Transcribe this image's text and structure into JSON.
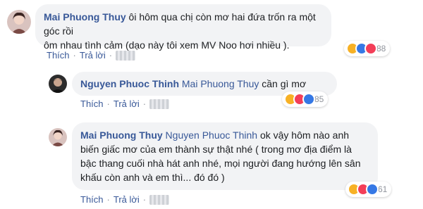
{
  "colors": {
    "author": "#385898",
    "bubble": "#f2f3f5",
    "haha": "#f7b125",
    "like": "#3578e5",
    "love": "#f33e58"
  },
  "comments": [
    {
      "author": "Mai Phuong Thuy",
      "line1": "ôi hôm qua chị còn mơ hai đứa trốn ra một góc rồi",
      "line2": "ôm nhau tình cảm (dạo này tôi xem MV Noo hơi nhiều ).",
      "actions": {
        "like": "Thích",
        "reply": "Trả lời"
      },
      "reactions": [
        "haha-icon",
        "like-icon",
        "love-icon"
      ],
      "reaction_count": "88"
    },
    {
      "author": "Nguyen Phuoc Thinh",
      "mention": "Mai Phuong Thuy",
      "text": "cần gì mơ",
      "actions": {
        "like": "Thích",
        "reply": "Trả lời"
      },
      "reactions": [
        "haha-icon",
        "love-icon",
        "like-icon"
      ],
      "reaction_count": "85"
    },
    {
      "author": "Mai Phuong Thuy",
      "mention": "Nguyen Phuoc Thinh",
      "line1": "ok vậy hôm nào anh",
      "line2": "biến giấc mơ của em thành sự thật nhé ( trong mơ địa điểm là",
      "line3": "bậc thang cuối nhà hát anh nhé, mọi người đang hướng lên sân",
      "line4": "khấu còn anh và em thì... đó đó )",
      "actions": {
        "like": "Thích",
        "reply": "Trả lời"
      },
      "reactions": [
        "haha-icon",
        "love-icon",
        "like-icon"
      ],
      "reaction_count": "61"
    }
  ]
}
